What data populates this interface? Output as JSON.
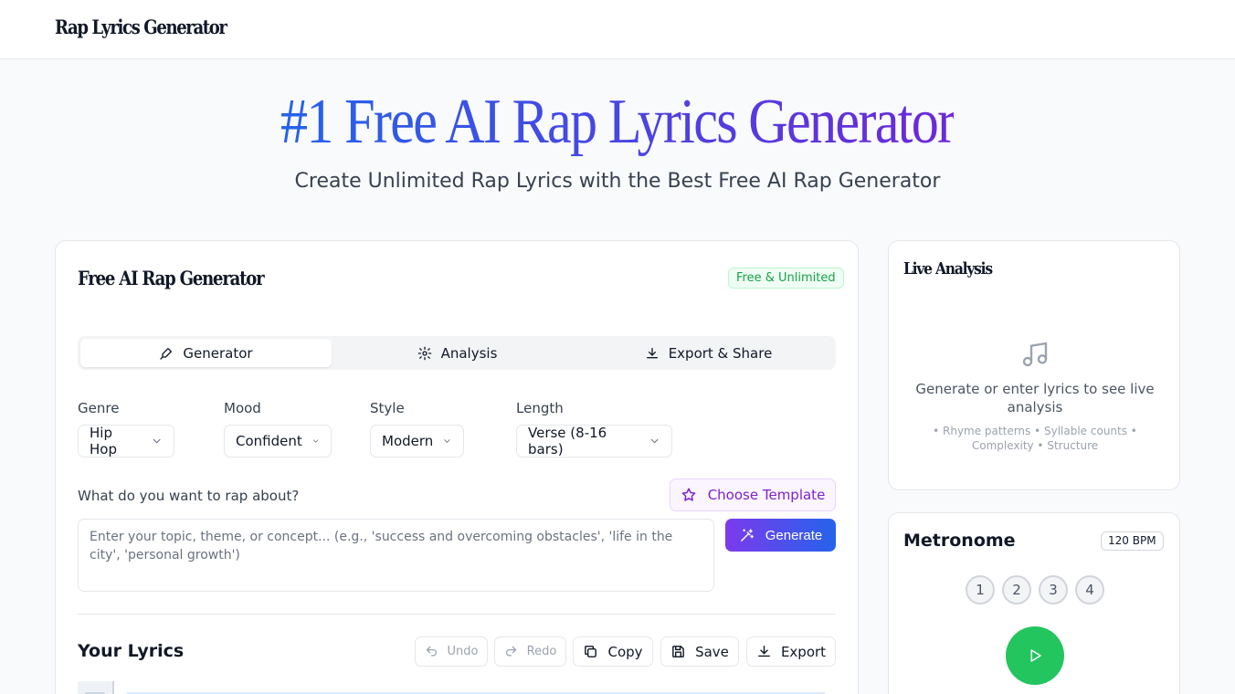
{
  "header": {
    "brand": "Rap Lyrics Generator"
  },
  "hero": {
    "title": "#1 Free AI Rap Lyrics Generator",
    "subtitle": "Create Unlimited Rap Lyrics with the Best Free AI Rap Generator"
  },
  "generator": {
    "title": "Free AI Rap Generator",
    "badge": "Free & Unlimited",
    "tabs": [
      {
        "label": "Generator",
        "icon": "pen-icon",
        "active": true
      },
      {
        "label": "Analysis",
        "icon": "gear-icon",
        "active": false
      },
      {
        "label": "Export & Share",
        "icon": "download-icon",
        "active": false
      }
    ],
    "fields": [
      {
        "label": "Genre",
        "value": "Hip Hop"
      },
      {
        "label": "Mood",
        "value": "Confident"
      },
      {
        "label": "Style",
        "value": "Modern"
      },
      {
        "label": "Length",
        "value": "Verse (8-16 bars)"
      }
    ],
    "topic_label": "What do you want to rap about?",
    "template_button": "Choose Template",
    "topic_placeholder": "Enter your topic, theme, or concept... (e.g., 'success and overcoming obstacles', 'life in the city', 'personal growth')",
    "generate_button": "Generate"
  },
  "lyrics": {
    "title": "Your Lyrics",
    "undo": "Undo",
    "redo": "Redo",
    "copy": "Copy",
    "save": "Save",
    "export": "Export"
  },
  "analysis": {
    "title": "Live Analysis",
    "icon": "music-note-icon",
    "message": "Generate or enter lyrics to see live analysis",
    "hint": "• Rhyme patterns • Syllable counts • Complexity • Structure"
  },
  "metronome": {
    "title": "Metronome",
    "bpm": "120 BPM",
    "beats": [
      "1",
      "2",
      "3",
      "4"
    ],
    "play_icon": "play-icon"
  },
  "colors": {
    "accent_purple": "#7c3aed",
    "accent_blue": "#2563eb",
    "success_green": "#22c55e",
    "badge_green": "#16a34a"
  }
}
